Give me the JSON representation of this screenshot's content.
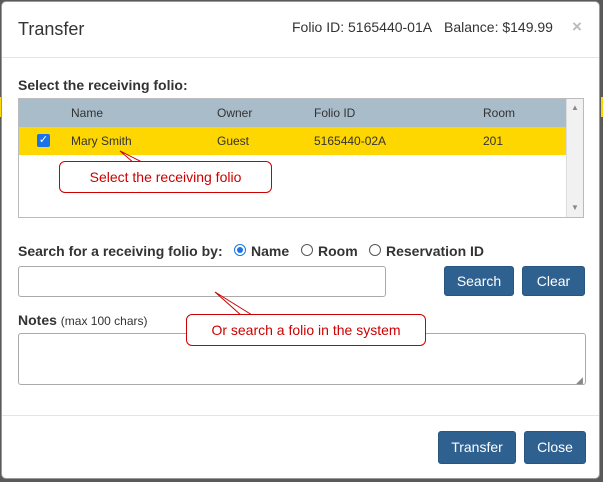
{
  "modal": {
    "title": "Transfer",
    "folio_id": "Folio ID: 5165440-01A",
    "balance": "Balance: $149.99",
    "close_glyph": "×"
  },
  "receiving": {
    "label": "Select the receiving folio:",
    "columns": [
      "Name",
      "Owner",
      "Folio ID",
      "Room"
    ],
    "rows": [
      {
        "checked": true,
        "name": "Mary Smith",
        "owner": "Guest",
        "folio_id": "5165440-02A",
        "room": "201"
      }
    ],
    "selected_row_color": "#ffd700"
  },
  "search": {
    "label": "Search for a receiving folio by:",
    "options": [
      "Name",
      "Room",
      "Reservation ID"
    ],
    "selected": "Name",
    "value": "",
    "search_button": "Search",
    "clear_button": "Clear"
  },
  "notes": {
    "label": "Notes",
    "hint": "(max 100 chars)",
    "value": ""
  },
  "footer": {
    "transfer_button": "Transfer",
    "close_button": "Close"
  },
  "callouts": {
    "select_folio": "Select the receiving folio",
    "search_folio": "Or search a folio in the system"
  },
  "colors": {
    "button": "#2f6190",
    "header_row": "#a9bcc9",
    "callout": "#cc0000",
    "radio_checked": "#1a73e8"
  }
}
